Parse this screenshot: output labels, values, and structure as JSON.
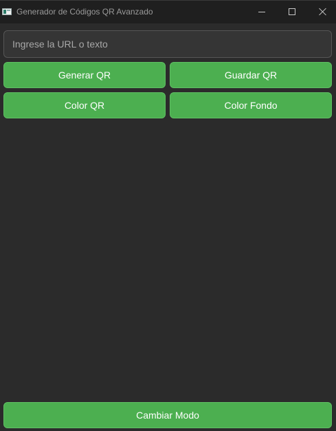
{
  "window": {
    "title": "Generador de Códigos QR Avanzado",
    "controls": {
      "minimize_icon": "minimize-icon",
      "maximize_icon": "maximize-icon",
      "close_icon": "close-icon"
    }
  },
  "input": {
    "placeholder": "Ingrese la URL o texto",
    "value": ""
  },
  "buttons": {
    "generate": "Generar QR",
    "save": "Guardar QR",
    "color_qr": "Color QR",
    "color_background": "Color Fondo",
    "toggle_mode": "Cambiar Modo"
  },
  "colors": {
    "background": "#2b2b2b",
    "titlebar": "#1f1f1f",
    "button": "#4caf50",
    "input": "#353535"
  }
}
